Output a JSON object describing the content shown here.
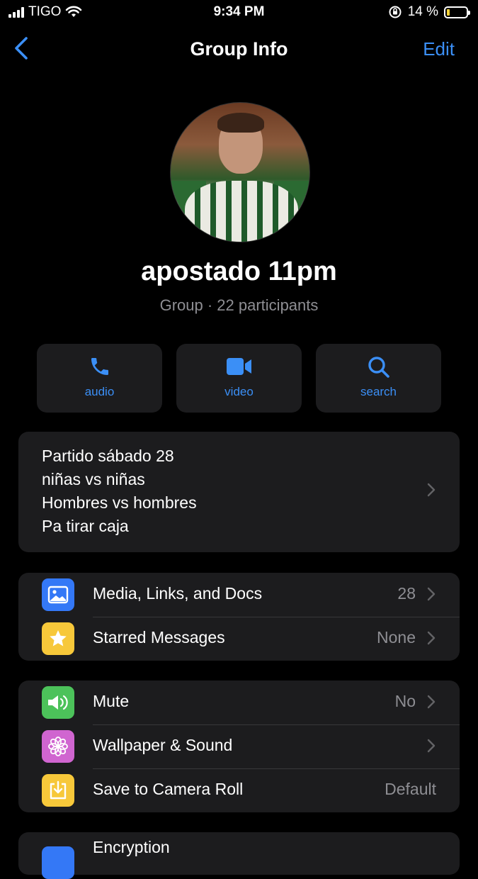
{
  "status_bar": {
    "carrier": "TIGO",
    "time": "9:34 PM",
    "battery_percent": "14 %",
    "battery_level": 0.14
  },
  "nav": {
    "title": "Group Info",
    "edit_label": "Edit"
  },
  "group": {
    "name": "apostado 11pm",
    "subtitle": "Group · 22 participants"
  },
  "actions": [
    {
      "label": "audio",
      "icon": "phone-icon"
    },
    {
      "label": "video",
      "icon": "video-camera-icon"
    },
    {
      "label": "search",
      "icon": "search-icon"
    }
  ],
  "description": {
    "lines": [
      "Partido sábado 28",
      "niñas vs niñas",
      "Hombres vs hombres",
      "Pa tirar caja"
    ]
  },
  "media_section": [
    {
      "label": "Media, Links, and Docs",
      "value": "28",
      "icon": "photo-icon",
      "color": "#3478f6"
    },
    {
      "label": "Starred Messages",
      "value": "None",
      "icon": "star-icon",
      "color": "#f7c83a"
    }
  ],
  "settings_section": [
    {
      "label": "Mute",
      "value": "No",
      "icon": "speaker-icon",
      "color": "#4cc25a"
    },
    {
      "label": "Wallpaper & Sound",
      "value": "",
      "icon": "flower-icon",
      "color": "#d065d0"
    },
    {
      "label": "Save to Camera Roll",
      "value": "Default",
      "icon": "download-icon",
      "color": "#f7c83a"
    }
  ],
  "encryption": {
    "label": "Encryption",
    "color": "#3478f6"
  },
  "colors": {
    "accent": "#3b8ff6",
    "card_bg": "#1c1c1e",
    "secondary_text": "#8e8e93"
  }
}
